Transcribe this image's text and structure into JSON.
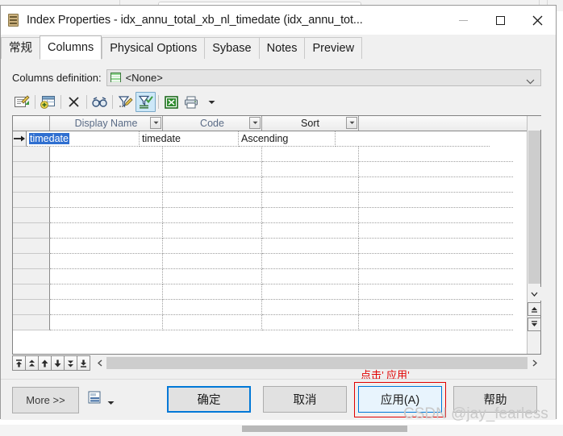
{
  "window": {
    "title": "Index Properties - idx_annu_total_xb_nl_timedate (idx_annu_tot...",
    "icon": "index-document-icon",
    "controls": {
      "minimize": "minimize-icon",
      "maximize": "maximize-icon",
      "close": "close-icon"
    }
  },
  "tabs": [
    {
      "label": "常规",
      "active": false
    },
    {
      "label": "Columns",
      "active": true
    },
    {
      "label": "Physical Options",
      "active": false
    },
    {
      "label": "Sybase",
      "active": false
    },
    {
      "label": "Notes",
      "active": false
    },
    {
      "label": "Preview",
      "active": false
    }
  ],
  "columns_definition": {
    "label": "Columns definition:",
    "value": "<None>",
    "icon": "grid-definition-icon"
  },
  "toolbar": [
    {
      "name": "properties-icon",
      "selected": false
    },
    {
      "name": "insert-row-icon",
      "selected": false
    },
    {
      "name": "delete-row-icon",
      "selected": false
    },
    {
      "name": "find-icon",
      "selected": false
    },
    {
      "name": "edit-filter-icon",
      "selected": false
    },
    {
      "name": "apply-filter-icon",
      "selected": true
    },
    {
      "name": "export-excel-icon",
      "selected": false
    },
    {
      "name": "print-icon",
      "selected": false
    },
    {
      "name": "print-dropdown-icon",
      "selected": false
    }
  ],
  "grid": {
    "headers": [
      "",
      "Display Name",
      "Code",
      "Sort",
      ""
    ],
    "rows": [
      {
        "marker": "current-row-arrow",
        "cells": [
          "timedate",
          "timedate",
          "Ascending",
          ""
        ],
        "selected_cell": 0
      }
    ],
    "empty_row_count": 12,
    "nav_buttons": [
      "move-to-first-icon",
      "move-up-fast-icon",
      "move-up-icon",
      "move-down-icon",
      "move-down-fast-icon",
      "move-to-last-icon"
    ],
    "scroll": {
      "up": "scroll-up-icon",
      "down": "scroll-down-icon",
      "first_row": "scroll-first-icon",
      "last_row": "scroll-last-icon",
      "left": "scroll-left-icon",
      "right": "scroll-right-icon"
    }
  },
  "footer": {
    "more_label": "More >>",
    "report_icon": "report-icon",
    "report_dropdown": "dropdown-arrow-icon",
    "ok_label": "确定",
    "cancel_label": "取消",
    "apply_label": "应用(A)",
    "help_label": "帮助"
  },
  "annotation": {
    "text": "点击’ 应用’",
    "color": "#e00000"
  },
  "watermark": {
    "text": "CSDN @jay_fearless"
  },
  "colors": {
    "accent": "#0078d7",
    "selection": "#2f6fd0",
    "annotation": "#e00000",
    "dialog_bg": "#f0f0f0"
  }
}
